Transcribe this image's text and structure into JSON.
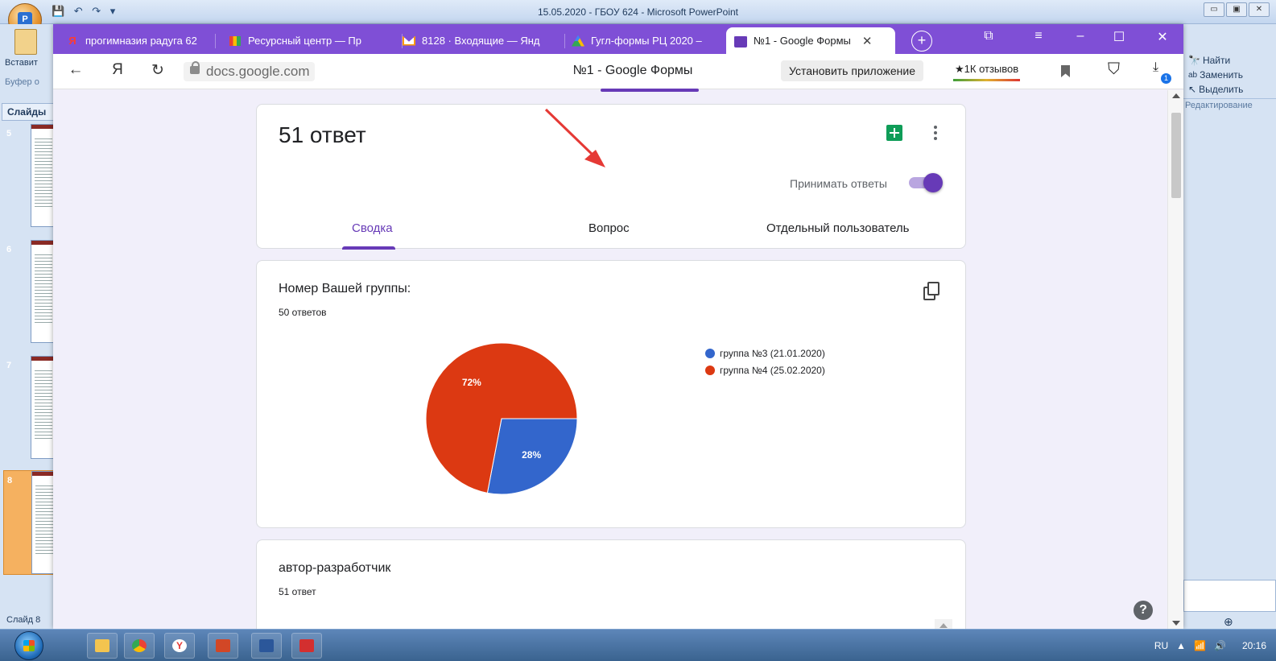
{
  "powerpoint": {
    "title": "15.05.2020 - ГБОУ 624 - Microsoft PowerPoint",
    "ribbon_paste": "Вставит",
    "ribbon_group": "Буфер о",
    "slides_tab": "Слайды",
    "slide_numbers": [
      "5",
      "6",
      "7",
      "8"
    ],
    "status_slide": "Слайд 8",
    "right_tools": {
      "find": "Найти",
      "replace": "Заменить",
      "select": "Выделить",
      "group": "Редактирование"
    }
  },
  "browser": {
    "tabs": [
      {
        "label": "прогимназия радуга 62",
        "icon": "yandex-icon"
      },
      {
        "label": "Ресурсный центр — Пр",
        "icon": "resource-icon"
      },
      {
        "label": "8128 · Входящие — Янд",
        "icon": "mail-icon"
      },
      {
        "label": "Гугл-формы РЦ 2020 –",
        "icon": "drive-icon"
      },
      {
        "label": "№1 - Google Формы",
        "icon": "forms-icon"
      }
    ],
    "url": "docs.google.com",
    "page_title": "№1 - Google Формы",
    "install_button": "Установить приложение",
    "reviews": "★1К отзывов"
  },
  "form": {
    "response_count": "51 ответ",
    "accept_responses_label": "Принимать ответы",
    "accept_responses": true,
    "tabs": [
      "Сводка",
      "Вопрос",
      "Отдельный пользователь"
    ],
    "active_tab": "Сводка",
    "question1": {
      "title": "Номер Вашей группы:",
      "count": "50 ответов"
    },
    "question2": {
      "title": "автор-разработчик",
      "count": "51 ответ"
    }
  },
  "chart_data": {
    "type": "pie",
    "categories": [
      "группа №3 (21.01.2020)",
      "группа №4 (25.02.2020)"
    ],
    "values": [
      28,
      72
    ],
    "labels": [
      "28%",
      "72%"
    ],
    "colors": [
      "#3366cc",
      "#dc3912"
    ],
    "legend": "right"
  },
  "taskbar": {
    "language": "RU",
    "time": "20:16"
  }
}
